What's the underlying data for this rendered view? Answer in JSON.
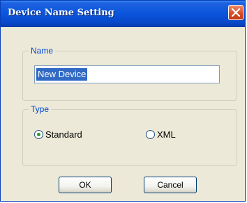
{
  "window": {
    "title": "Device Name Setting",
    "close_icon": "close-icon"
  },
  "name_group": {
    "label": "Name",
    "value": "New Device"
  },
  "type_group": {
    "label": "Type",
    "options": [
      {
        "label": "Standard",
        "selected": true
      },
      {
        "label": "XML",
        "selected": false
      }
    ]
  },
  "buttons": {
    "ok_label": "OK",
    "cancel_label": "Cancel"
  },
  "colors": {
    "title_bar": "#0a55db",
    "close_button": "#d8491f",
    "legend_text": "#0046d5",
    "selection": "#316ac5",
    "radio_dot": "#2b9a2b"
  }
}
